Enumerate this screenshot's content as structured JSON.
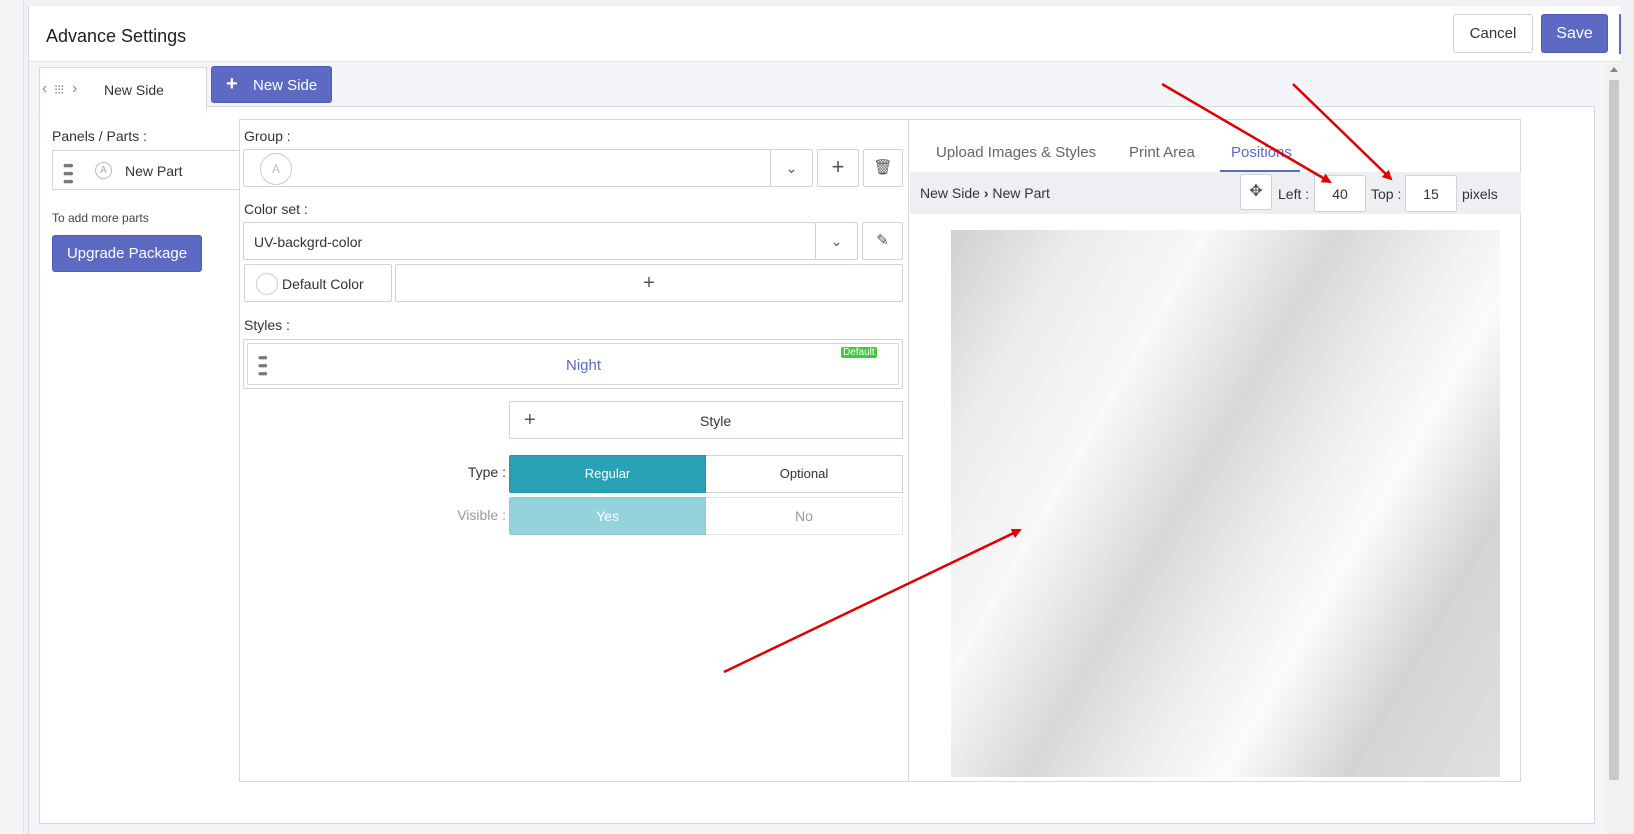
{
  "header": {
    "title": "Advance Settings",
    "cancel_label": "Cancel",
    "save_label": "Save"
  },
  "sides": {
    "active_tab": "New Side",
    "new_side_label": "New Side"
  },
  "left": {
    "panels_label": "Panels / Parts :",
    "part_name": "New Part",
    "part_icon_letter": "A",
    "add_more_text": "To add more parts",
    "upgrade_label": "Upgrade Package"
  },
  "form": {
    "group_label": "Group :",
    "group_icon_letter": "A",
    "color_set_label": "Color set :",
    "color_set_value": "UV-backgrd-color",
    "default_color_label": "Default Color",
    "styles_label": "Styles :",
    "style_name": "Night",
    "style_badge": "Default",
    "add_style_label": "Style",
    "type_label": "Type :",
    "type_options": [
      "Regular",
      "Optional"
    ],
    "visible_label": "Visible :",
    "visible_options": [
      "Yes",
      "No"
    ]
  },
  "right": {
    "tabs": [
      "Upload Images & Styles",
      "Print Area",
      "Positions"
    ],
    "active_tab": "Positions",
    "breadcrumb_side": "New Side",
    "breadcrumb_part": "New Part",
    "left_label": "Left :",
    "left_value": "40",
    "top_label": "Top :",
    "top_value": "15",
    "unit_label": "pixels"
  },
  "colors": {
    "accent": "#5c6ac4",
    "teal": "#28a2b4",
    "teal_light": "#95d3dc",
    "arrow": "#e00000",
    "badge": "#3ec93e"
  }
}
